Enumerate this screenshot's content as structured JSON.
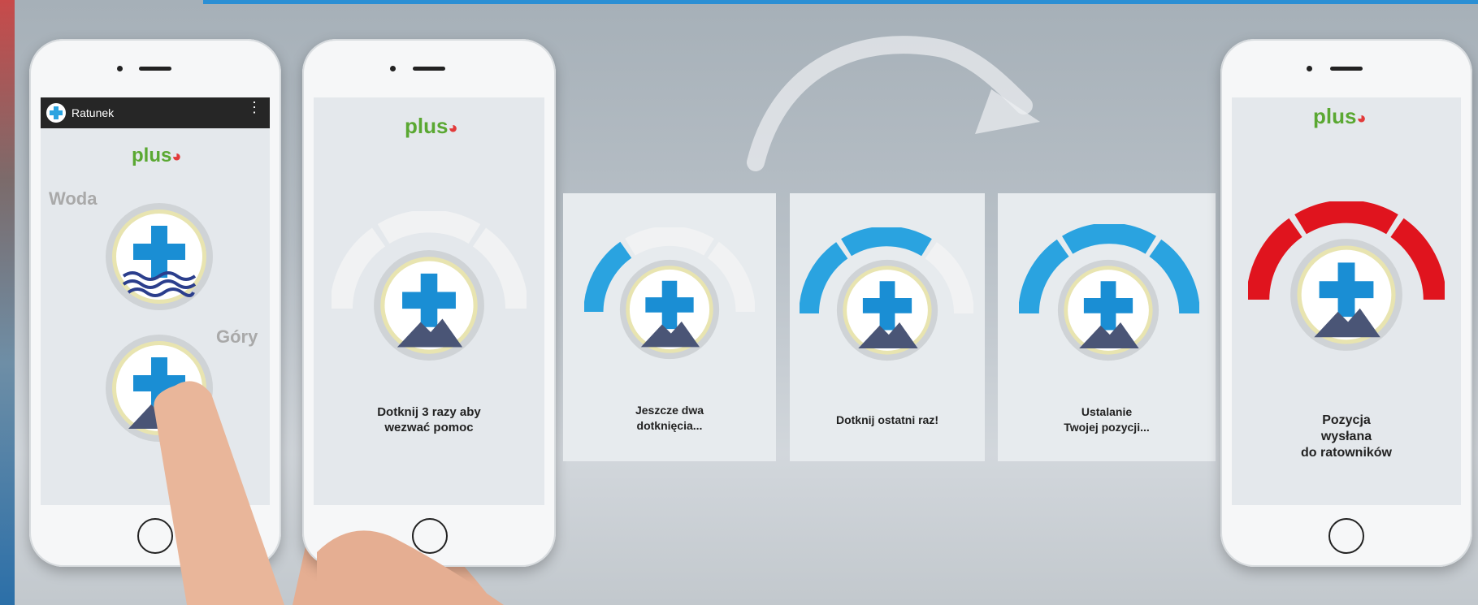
{
  "app": {
    "title": "Ratunek",
    "logo_text": "plus",
    "logo_mark": "⚫"
  },
  "phone1": {
    "labels": {
      "water": "Woda",
      "mountains": "Góry"
    },
    "menu_icon": "more-vert-icon"
  },
  "steps": [
    {
      "caption": "Dotknij 3 razy aby\nwezwać pomoc",
      "filled": 0,
      "color": "#2aa3e0"
    },
    {
      "caption": "Jeszcze dwa\ndotknięcia...",
      "filled": 1,
      "color": "#2aa3e0"
    },
    {
      "caption": "Dotknij ostatni raz!",
      "filled": 2,
      "color": "#2aa3e0"
    },
    {
      "caption": "Ustalanie\nTwojej pozycji...",
      "filled": 3,
      "color": "#2aa3e0"
    },
    {
      "caption": "Pozycja\nwysłana\ndo ratowników",
      "filled": 3,
      "color": "#e0141e"
    }
  ],
  "colors": {
    "accent_blue": "#2aa3e0",
    "alert_red": "#e0141e",
    "brand_green": "#5aa832"
  }
}
